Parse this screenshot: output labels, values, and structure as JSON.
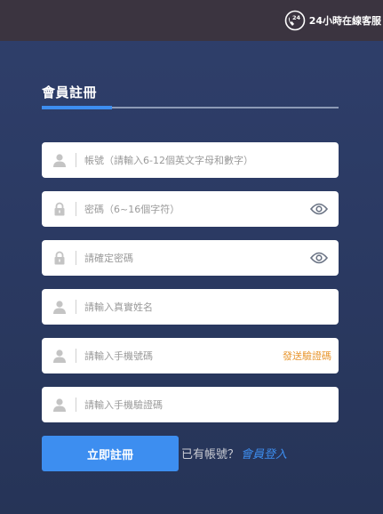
{
  "topbar": {
    "service_badge": "24",
    "service_label": "24小時在線客服"
  },
  "form": {
    "title": "會員註冊",
    "fields": [
      {
        "placeholder": "帳號（請輸入6-12個英文字母和數字）",
        "icon": "user-icon"
      },
      {
        "placeholder": "密碼（6~16個字符）",
        "icon": "lock-icon",
        "has_eye": true
      },
      {
        "placeholder": "請確定密碼",
        "icon": "lock-icon",
        "has_eye": true
      },
      {
        "placeholder": "請輸入真實姓名",
        "icon": "user-icon"
      },
      {
        "placeholder": "請輸入手機號碼",
        "icon": "user-icon",
        "action": "發送驗證碼"
      },
      {
        "placeholder": "請輸入手機驗證碼",
        "icon": "user-icon"
      }
    ],
    "submit_label": "立即註冊",
    "have_account": "已有帳號？",
    "login_label": "會員登入"
  },
  "colors": {
    "accent": "#3d8ef0",
    "sms_link": "#e8962e",
    "background": "#2b3a63",
    "topbar": "#3b3440"
  }
}
